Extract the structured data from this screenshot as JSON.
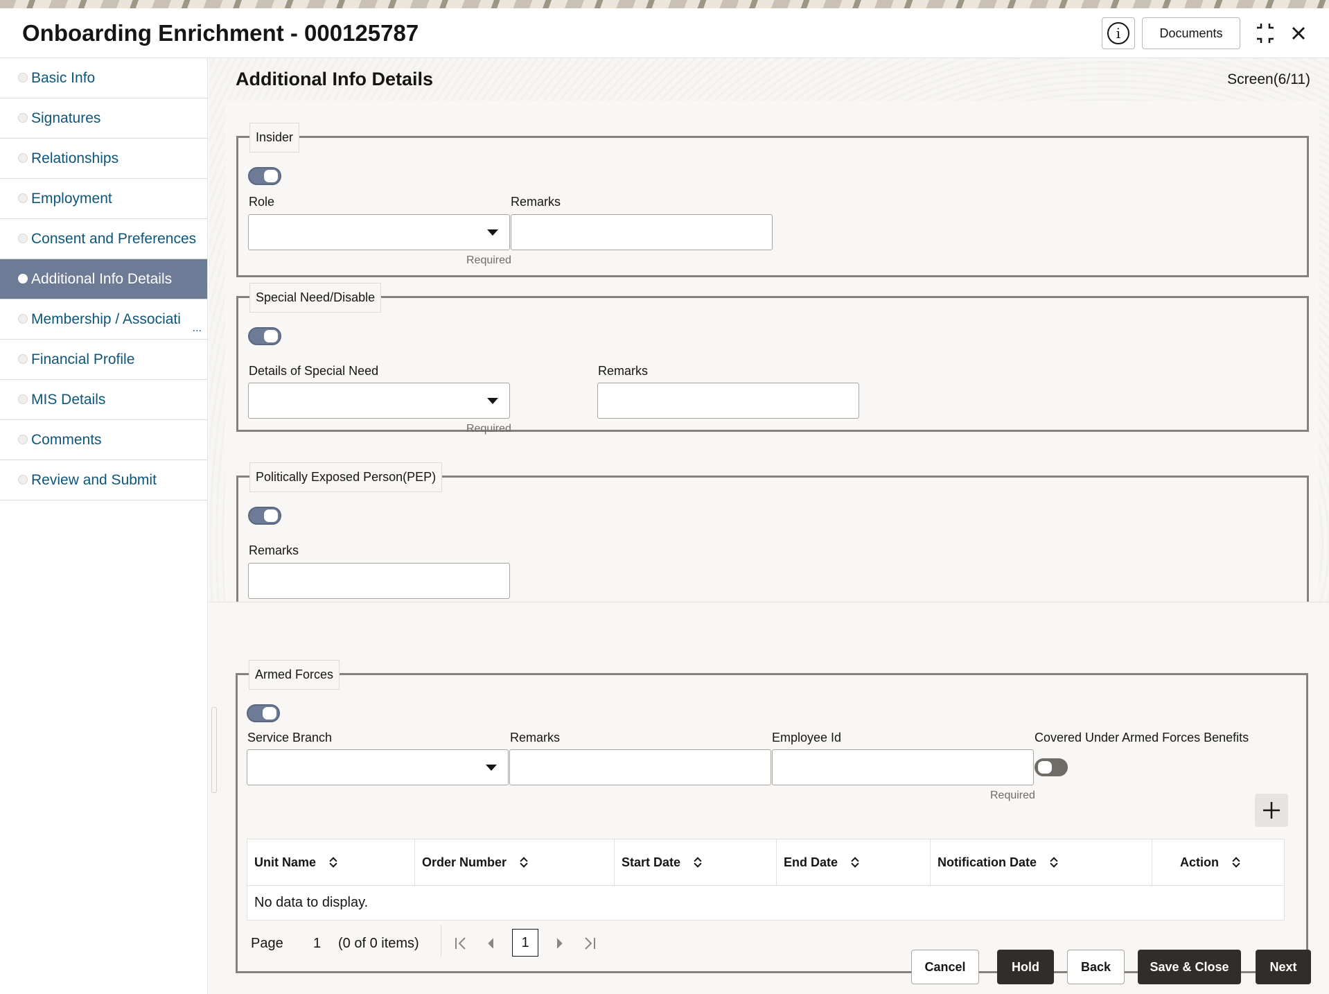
{
  "header": {
    "title": "Onboarding Enrichment - 000125787",
    "documents_label": "Documents"
  },
  "sidebar": {
    "items": [
      {
        "label": "Basic Info",
        "active": false
      },
      {
        "label": "Signatures",
        "active": false
      },
      {
        "label": "Relationships",
        "active": false
      },
      {
        "label": "Employment",
        "active": false
      },
      {
        "label": "Consent and Preferences",
        "active": false
      },
      {
        "label": "Additional Info Details",
        "active": true
      },
      {
        "label": "Membership / Associati",
        "active": false,
        "truncated": true
      },
      {
        "label": "Financial Profile",
        "active": false
      },
      {
        "label": "MIS Details",
        "active": false
      },
      {
        "label": "Comments",
        "active": false
      },
      {
        "label": "Review and Submit",
        "active": false
      }
    ],
    "more": "..."
  },
  "main": {
    "title": "Additional Info Details",
    "screen_counter": "Screen(6/11)",
    "insider": {
      "legend": "Insider",
      "toggle_on": true,
      "role_label": "Role",
      "role_value": "",
      "role_hint": "Required",
      "remarks_label": "Remarks",
      "remarks_value": ""
    },
    "special_need": {
      "legend": "Special Need/Disable",
      "toggle_on": true,
      "details_label": "Details of Special Need",
      "details_value": "",
      "details_hint": "Required",
      "remarks_label": "Remarks",
      "remarks_value": ""
    },
    "pep": {
      "legend": "Politically Exposed Person(PEP)",
      "toggle_on": true,
      "remarks_label": "Remarks",
      "remarks_value": ""
    },
    "armed_forces": {
      "legend": "Armed Forces",
      "toggle_on": true,
      "service_branch_label": "Service Branch",
      "service_branch_value": "",
      "remarks_label": "Remarks",
      "remarks_value": "",
      "employee_id_label": "Employee Id",
      "employee_id_value": "",
      "employee_id_hint": "Required",
      "benefits_label": "Covered Under Armed Forces Benefits",
      "benefits_on": false,
      "table": {
        "columns": [
          "Unit Name",
          "Order Number",
          "Start Date",
          "End Date",
          "Notification Date",
          "Action"
        ],
        "rows": [],
        "empty_text": "No data to display."
      },
      "pager": {
        "page_label": "Page",
        "page_number": "1",
        "items_text": "(0 of 0 items)",
        "current_page": "1"
      }
    }
  },
  "footer": {
    "cancel": "Cancel",
    "hold": "Hold",
    "back": "Back",
    "save_close": "Save & Close",
    "next": "Next"
  },
  "colors": {
    "accent": "#6d7b96",
    "link": "#0e5679",
    "dark_button": "#312d2a",
    "border": "#85827d"
  }
}
